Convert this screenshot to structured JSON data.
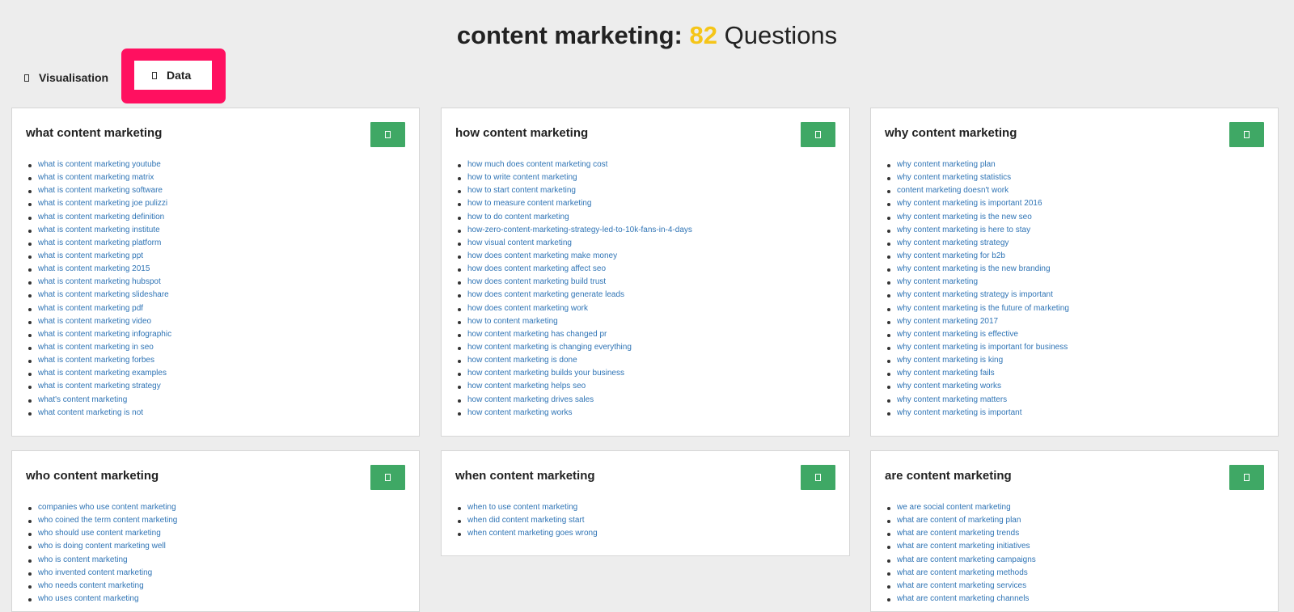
{
  "title": {
    "keyword": "content marketing:",
    "count": "82",
    "suffix": "Questions"
  },
  "tabs": {
    "visualisation": "Visualisation",
    "data": "Data"
  },
  "sections": [
    {
      "heading": "what content marketing",
      "items": [
        "what is content marketing youtube",
        "what is content marketing matrix",
        "what is content marketing software",
        "what is content marketing joe pulizzi",
        "what is content marketing definition",
        "what is content marketing institute",
        "what is content marketing platform",
        "what is content marketing ppt",
        "what is content marketing 2015",
        "what is content marketing hubspot",
        "what is content marketing slideshare",
        "what is content marketing pdf",
        "what is content marketing video",
        "what is content marketing infographic",
        "what is content marketing in seo",
        "what is content marketing forbes",
        "what is content marketing examples",
        "what is content marketing strategy",
        "what's content marketing",
        "what content marketing is not"
      ]
    },
    {
      "heading": "how content marketing",
      "items": [
        "how much does content marketing cost",
        "how to write content marketing",
        "how to start content marketing",
        "how to measure content marketing",
        "how to do content marketing",
        "how-zero-content-marketing-strategy-led-to-10k-fans-in-4-days",
        "how visual content marketing",
        "how does content marketing make money",
        "how does content marketing affect seo",
        "how does content marketing build trust",
        "how does content marketing generate leads",
        "how does content marketing work",
        "how to content marketing",
        "how content marketing has changed pr",
        "how content marketing is changing everything",
        "how content marketing is done",
        "how content marketing builds your business",
        "how content marketing helps seo",
        "how content marketing drives sales",
        "how content marketing works"
      ]
    },
    {
      "heading": "why content marketing",
      "items": [
        "why content marketing plan",
        "why content marketing statistics",
        "content marketing doesn't work",
        "why content marketing is important 2016",
        "why content marketing is the new seo",
        "why content marketing is here to stay",
        "why content marketing strategy",
        "why content marketing for b2b",
        "why content marketing is the new branding",
        "why content marketing",
        "why content marketing strategy is important",
        "why content marketing is the future of marketing",
        "why content marketing 2017",
        "why content marketing is effective",
        "why content marketing is important for business",
        "why content marketing is king",
        "why content marketing fails",
        "why content marketing works",
        "why content marketing matters",
        "why content marketing is important"
      ]
    },
    {
      "heading": "who content marketing",
      "items": [
        "companies who use content marketing",
        "who coined the term content marketing",
        "who should use content marketing",
        "who is doing content marketing well",
        "who is content marketing",
        "who invented content marketing",
        "who needs content marketing",
        "who uses content marketing"
      ]
    },
    {
      "heading": "when content marketing",
      "items": [
        "when to use content marketing",
        "when did content marketing start",
        "when content marketing goes wrong"
      ]
    },
    {
      "heading": "are content marketing",
      "items": [
        "we are social content marketing",
        "what are content of marketing plan",
        "what are content marketing trends",
        "what are content marketing initiatives",
        "what are content marketing campaigns",
        "what are content marketing methods",
        "what are content marketing services",
        "what are content marketing channels"
      ]
    }
  ],
  "icons": {
    "tab_icon": "square-icon",
    "copy_icon": "copy-icon"
  },
  "colors": {
    "accent_count": "#f5c518",
    "copy_button": "#3fa865",
    "highlight": "#ff1060",
    "link": "#2f74b5"
  }
}
